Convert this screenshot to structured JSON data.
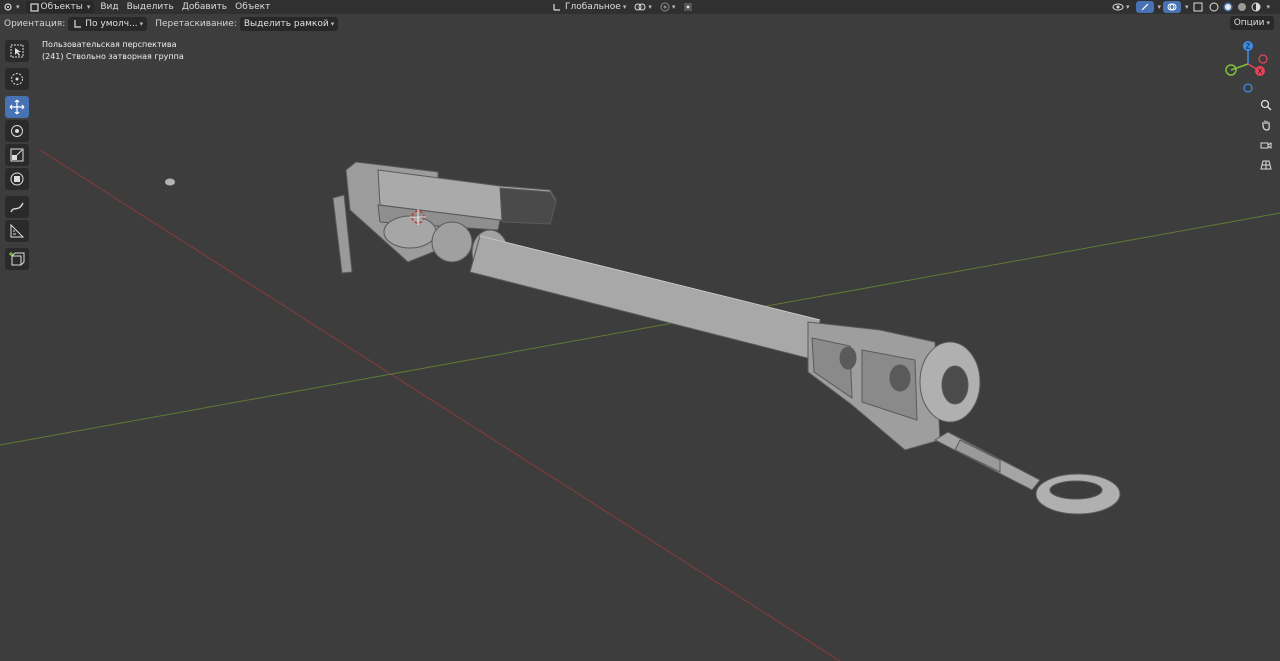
{
  "header": {
    "menus": [
      "Объекты",
      "Вид",
      "Выделить",
      "Добавить",
      "Объект"
    ],
    "transform_orientation": "Глобальное"
  },
  "toolbar": {
    "orientation_label": "Ориентация:",
    "orientation_value": "По умолч...",
    "drag_label": "Перетаскивание:",
    "drag_value": "Выделить рамкой",
    "options_label": "Опции"
  },
  "overlay": {
    "view_name": "Пользовательская перспектива",
    "object_info": "(241) Ствольно затворная группа"
  },
  "gizmo": {
    "x_label": "X",
    "y_label": "Y",
    "z_label": "Z",
    "colors": {
      "x": "#e8435c",
      "y": "#7fbf3a",
      "z": "#3d8eea"
    }
  },
  "tools": [
    "select-box-icon",
    "cursor-icon",
    "move-icon",
    "rotate-icon",
    "scale-icon",
    "transform-icon",
    "annotate-icon",
    "measure-icon",
    "add-cube-icon"
  ],
  "icons": [
    "editor-type-icon",
    "object-mode-icon",
    "snap-icon",
    "proportional-icon",
    "visibility-icon",
    "gizmo-icon",
    "overlay-icon",
    "xray-icon",
    "wireframe-icon",
    "solid-icon",
    "material-icon",
    "rendered-icon",
    "zoom-icon",
    "hand-icon",
    "camera-icon",
    "grid-icon"
  ]
}
